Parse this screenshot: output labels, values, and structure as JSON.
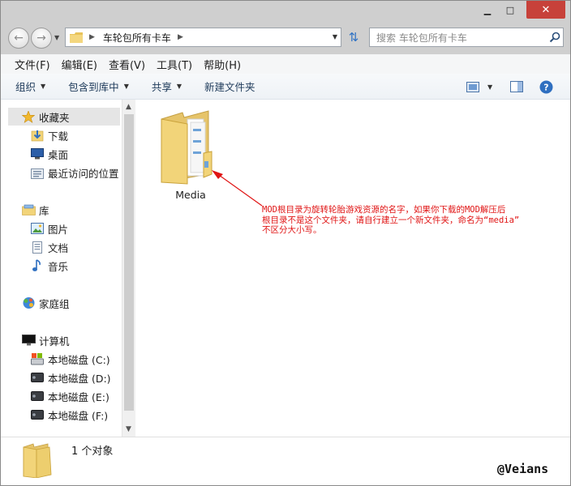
{
  "window": {
    "caption_min": "▁",
    "caption_max": "□",
    "caption_close": "✕"
  },
  "address": {
    "path_text": "车轮包所有卡车",
    "search_placeholder": "搜索 车轮包所有卡车"
  },
  "menu": {
    "items": [
      "文件(F)",
      "编辑(E)",
      "查看(V)",
      "工具(T)",
      "帮助(H)"
    ]
  },
  "toolbar": {
    "organize": "组织",
    "include_in_library": "包含到库中",
    "share": "共享",
    "new_folder": "新建文件夹"
  },
  "sidebar": {
    "favorites": "收藏夹",
    "downloads": "下载",
    "desktop": "桌面",
    "recent": "最近访问的位置",
    "libraries": "库",
    "pictures": "图片",
    "documents": "文档",
    "music": "音乐",
    "homegroup": "家庭组",
    "computer": "计算机",
    "drive_c": "本地磁盘 (C:)",
    "drive_d": "本地磁盘 (D:)",
    "drive_e": "本地磁盘 (E:)",
    "drive_f": "本地磁盘 (F:)"
  },
  "content": {
    "folder_name": "Media",
    "annotation_line1": "MOD根目录为旋转轮胎游戏资源的名字，如果你下载的MOD解压后",
    "annotation_line2": "根目录不是这个文件夹，请自行建立一个新文件夹，命名为“media”",
    "annotation_line3": "不区分大小写。"
  },
  "status": {
    "count_text": "1 个对象",
    "watermark": "@Veians"
  },
  "colors": {
    "annotation": "#e01414",
    "close_button": "#c7413a",
    "folder": "#f2d479"
  }
}
